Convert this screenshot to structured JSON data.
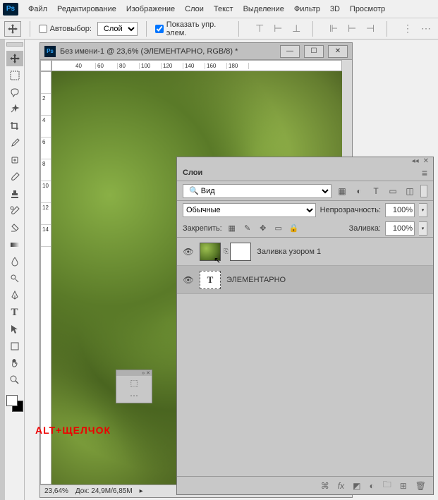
{
  "menubar": {
    "items": [
      "Файл",
      "Редактирование",
      "Изображение",
      "Слои",
      "Текст",
      "Выделение",
      "Фильтр",
      "3D",
      "Просмотр"
    ]
  },
  "options": {
    "autoselect_label": "Автовыбор:",
    "target_dropdown": "Слой",
    "show_controls_label": "Показать упр. элем."
  },
  "document": {
    "title": "Без имени-1 @ 23,6% (ЭЛЕМЕНТАРНО, RGB/8) *",
    "zoom": "23,64%",
    "doc_size": "Док: 24,9M/6,85M",
    "ruler_h": [
      "",
      "40",
      "60",
      "80",
      "100",
      "120",
      "140",
      "160",
      "180"
    ],
    "ruler_v": [
      "",
      "2",
      "4",
      "6",
      "8",
      "10",
      "12",
      "14"
    ]
  },
  "annotation": "ALT+ЩЕЛЧОК",
  "layers_panel": {
    "tab_label": "Слои",
    "search_kind": "Вид",
    "blend_mode": "Обычные",
    "opacity_label": "Непрозрачность:",
    "opacity_value": "100%",
    "lock_label": "Закрепить:",
    "fill_label": "Заливка:",
    "fill_value": "100%",
    "layers": [
      {
        "name": "Заливка узором 1",
        "type": "pattern",
        "selected": false
      },
      {
        "name": "ЭЛЕМЕНТАРНО",
        "type": "text",
        "selected": true
      }
    ]
  }
}
